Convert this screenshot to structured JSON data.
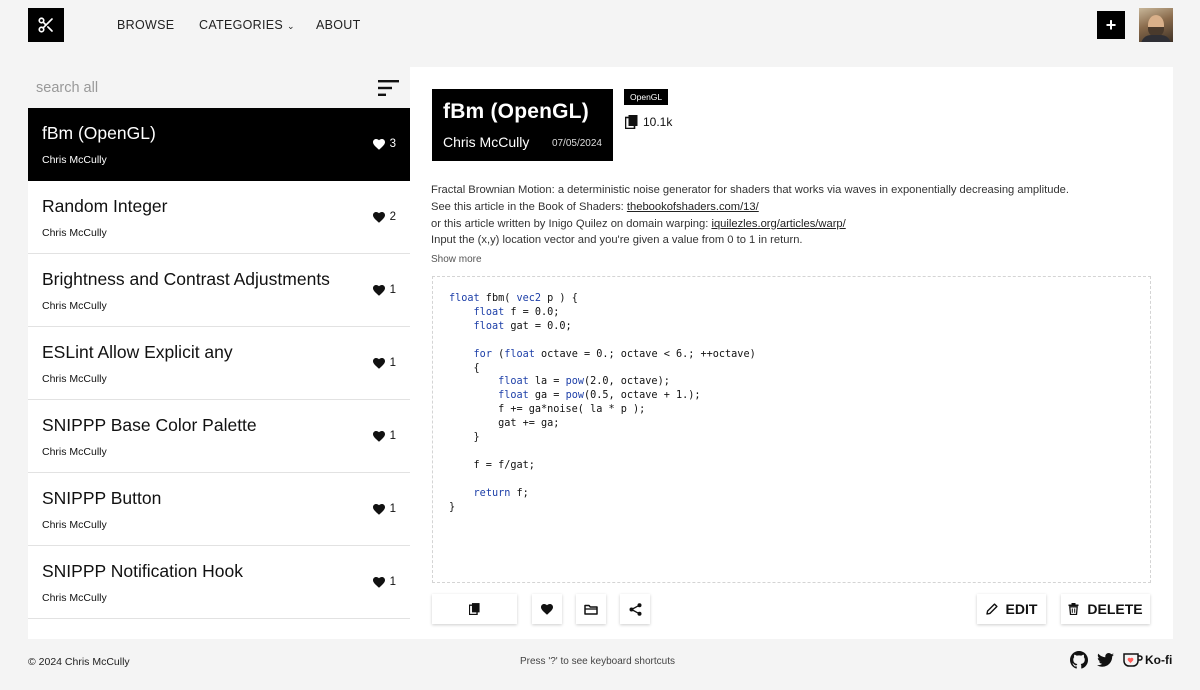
{
  "header": {
    "nav": {
      "browse": "BROWSE",
      "categories": "CATEGORIES",
      "about": "ABOUT"
    },
    "add_label": "+"
  },
  "sidebar": {
    "search_placeholder": "search all",
    "items": [
      {
        "title": "fBm (OpenGL)",
        "author": "Chris McCully",
        "likes": "3"
      },
      {
        "title": "Random Integer",
        "author": "Chris McCully",
        "likes": "2"
      },
      {
        "title": "Brightness and Contrast Adjustments",
        "author": "Chris McCully",
        "likes": "1"
      },
      {
        "title": "ESLint Allow Explicit any",
        "author": "Chris McCully",
        "likes": "1"
      },
      {
        "title": "SNIPPP Base Color Palette",
        "author": "Chris McCully",
        "likes": "1"
      },
      {
        "title": "SNIPPP Button",
        "author": "Chris McCully",
        "likes": "1"
      },
      {
        "title": "SNIPPP Notification Hook",
        "author": "Chris McCully",
        "likes": "1"
      }
    ]
  },
  "detail": {
    "title": "fBm (OpenGL)",
    "author": "Chris McCully",
    "date": "07/05/2024",
    "tag": "OpenGL",
    "copies": "10.1k",
    "description": {
      "line1": "Fractal Brownian Motion: a deterministic noise generator for shaders that works via waves in exponentially decreasing amplitude.",
      "line2_prefix": "See this article in the Book of Shaders: ",
      "line2_link": "thebookofshaders.com/13/",
      "line3_prefix": "or this article written by Inigo Quilez on domain warping: ",
      "line3_link": "iquilezles.org/articles/warp/",
      "line4": "Input the (x,y) location vector and you're given a value from 0 to 1 in return."
    },
    "show_more": "Show more",
    "edit_label": "EDIT",
    "delete_label": "DELETE"
  },
  "footer": {
    "copyright": "© 2024 Chris McCully",
    "hint": "Press '?' to see keyboard shortcuts",
    "kofi": "Ko-fi"
  },
  "icons": {
    "logo": "scissors-icon",
    "sort": "sort-icon",
    "heart": "heart-icon",
    "copy": "copy-icon",
    "folder": "folder-icon",
    "share": "share-icon",
    "edit": "pencil-icon",
    "delete": "trash-icon",
    "github": "github-icon",
    "twitter": "twitter-icon"
  },
  "colors": {
    "accent": "#000000",
    "code_keyword": "#1d3fa8",
    "background": "#f4f4f4"
  }
}
